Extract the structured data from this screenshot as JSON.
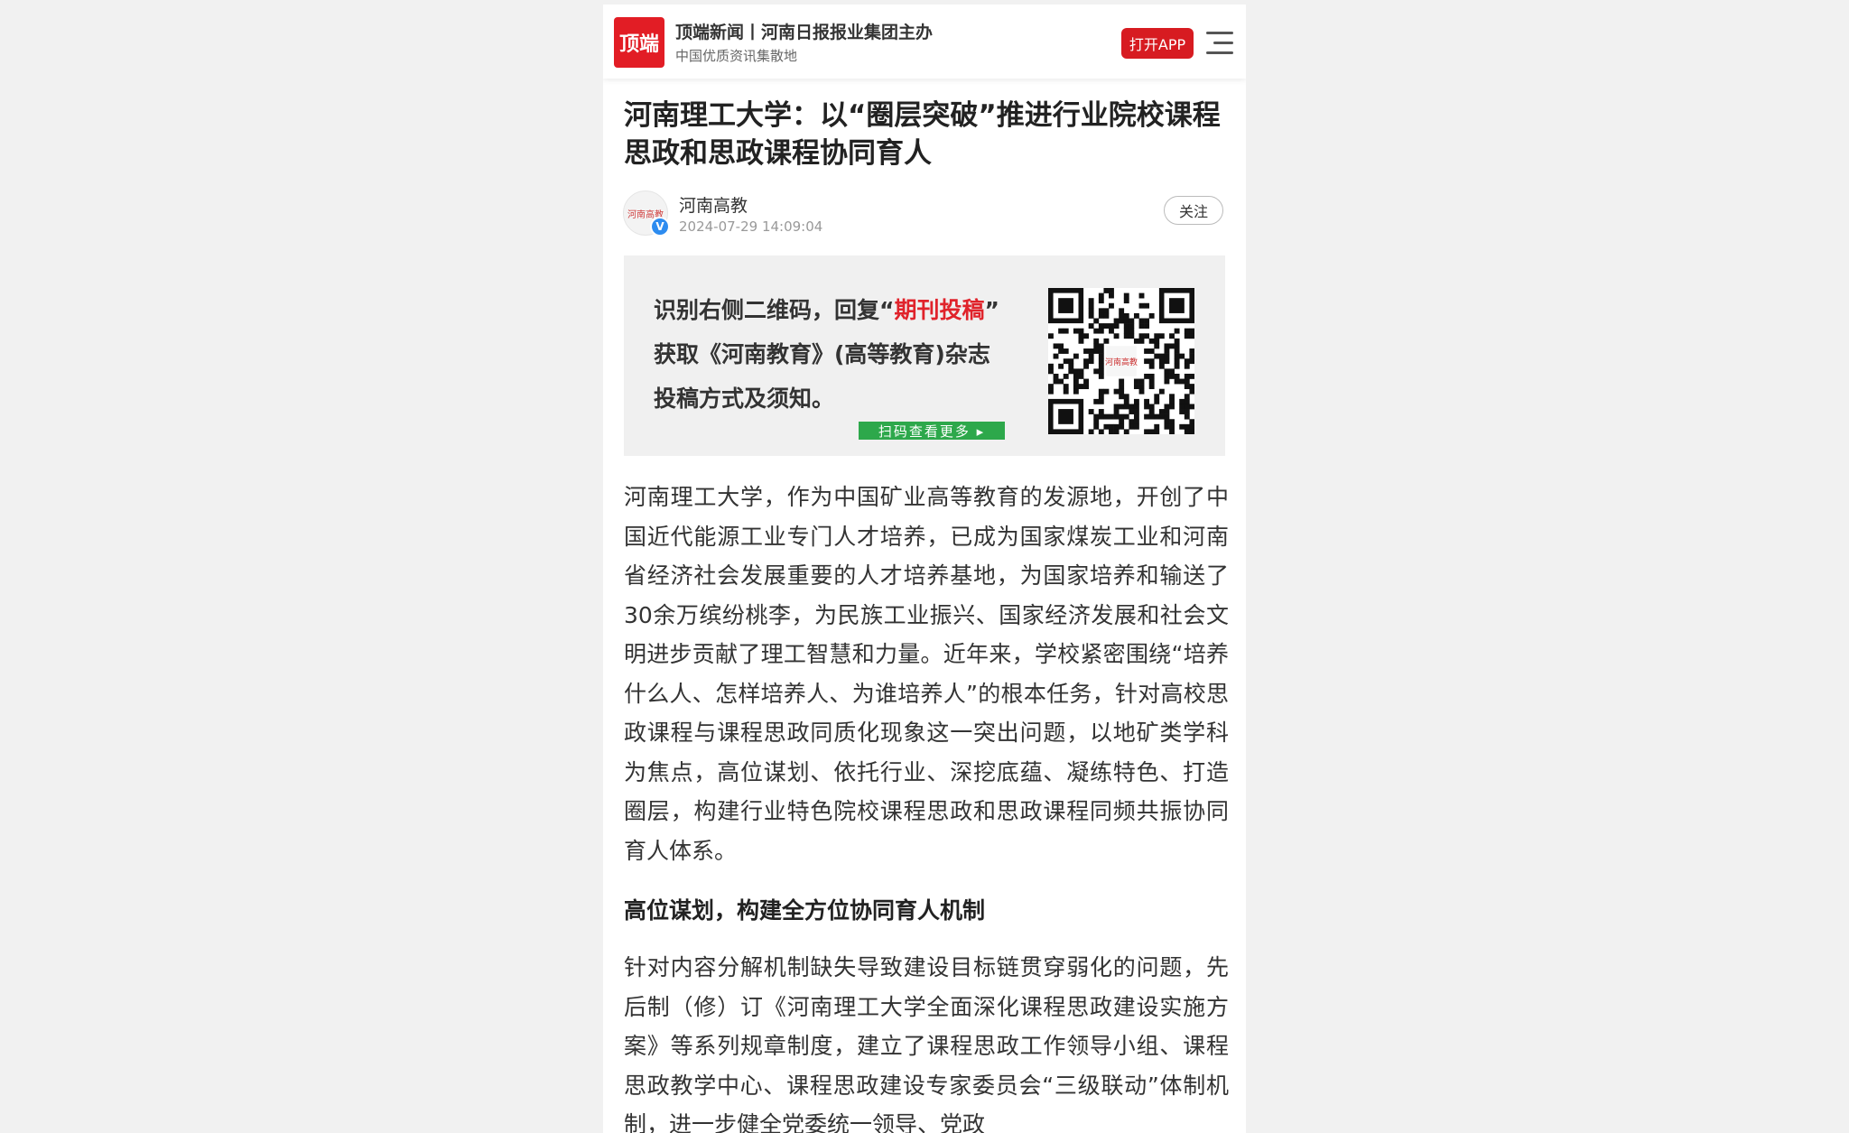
{
  "header": {
    "logo_text": "顶端",
    "brand_line": "顶端新闻丨河南日报报业集团主办",
    "tagline": "中国优质资讯集散地",
    "open_app_label": "打开APP",
    "menu_icon": "hamburger-menu-icon"
  },
  "article": {
    "title": "河南理工大学：以“圈层突破”推进行业院校课程思政和思政课程协同育人",
    "author": "河南高教",
    "verified_badge": "V",
    "avatar_text": "河南高教",
    "timestamp": "2024-07-29 14:09:04",
    "follow_label": "关注"
  },
  "banner": {
    "line1_prefix": "识别右侧二维码，回复“",
    "line1_highlight": "期刊投稿",
    "line1_suffix": "”",
    "line2": "获取《河南教育》(高等教育)杂志",
    "line3": "投稿方式及须知。",
    "scan_more": "扫码查看更多 ▸",
    "qr_icon": "qr-code-icon",
    "highlight_color": "#e0232b",
    "button_color": "#2da84b"
  },
  "body": {
    "paragraph1": "河南理工大学，作为中国矿业高等教育的发源地，开创了中国近代能源工业专门人才培养，已成为国家煤炭工业和河南省经济社会发展重要的人才培养基地，为国家培养和输送了30余万缤纷桃李，为民族工业振兴、国家经济发展和社会文明进步贡献了理工智慧和力量。近年来，学校紧密围绕“培养什么人、怎样培养人、为谁培养人”的根本任务，针对高校思政课程与课程思政同质化现象这一突出问题，以地矿类学科为焦点，高位谋划、依托行业、深挖底蕴、凝练特色、打造圈层，构建行业特色院校课程思政和思政课程同频共振协同育人体系。",
    "subheading1": "高位谋划，构建全方位协同育人机制",
    "paragraph2": "针对内容分解机制缺失导致建设目标链贯穿弱化的问题，先后制（修）订《河南理工大学全面深化课程思政建设实施方案》等系列规章制度，建立了课程思政工作领导小组、课程思政教学中心、课程思政建设专家委员会“三级联动”体制机制，进一步健全党委统一领导、党政"
  },
  "colors": {
    "brand_red": "#e21d25",
    "page_bg": "#f1f1f1"
  }
}
